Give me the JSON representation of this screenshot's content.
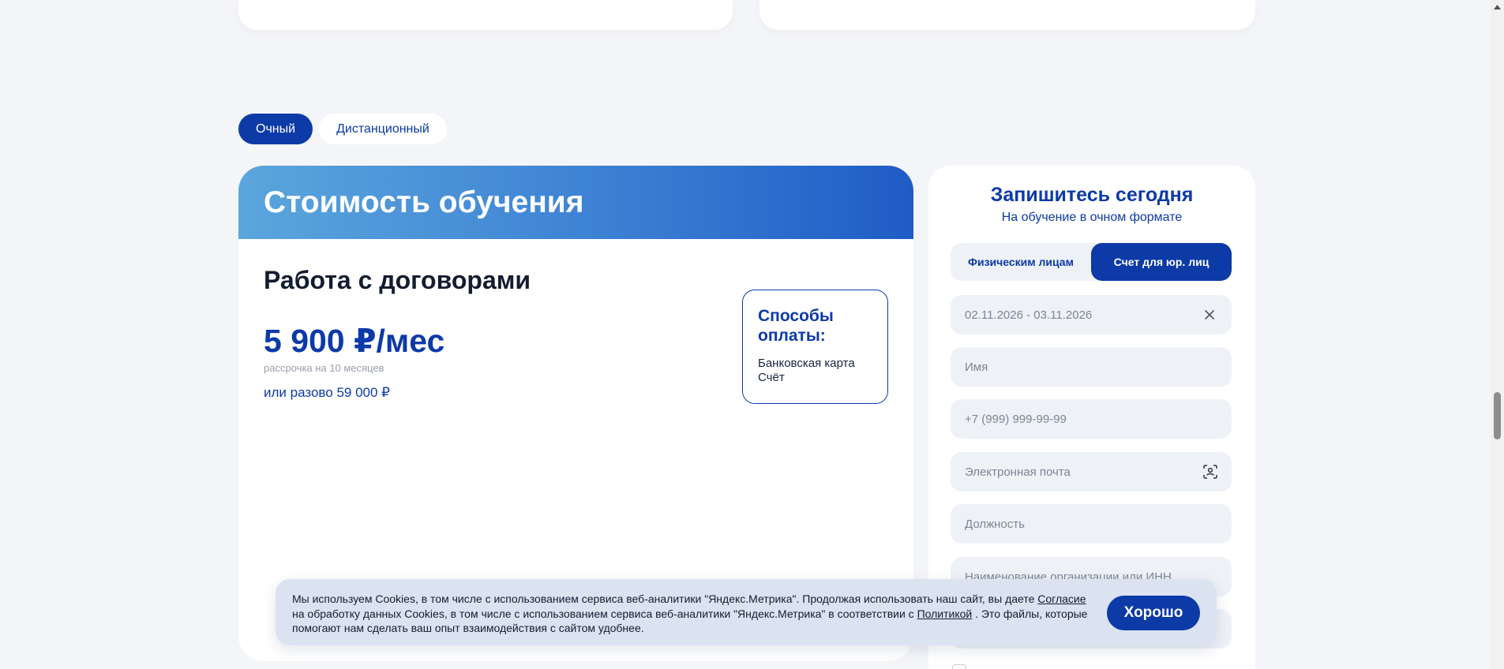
{
  "format_tabs": [
    {
      "label": "Очный",
      "active": true
    },
    {
      "label": "Дистанционный",
      "active": false
    }
  ],
  "price_card": {
    "header": "Стоимость обучения",
    "course_title": "Работа с договорами",
    "price_monthly": "5 900 ₽/мес",
    "installment_note": "рассрочка на 10 месяцев",
    "once_prefix": "или разово",
    "once_price": "59 000 ₽",
    "payment_methods": {
      "title": "Способы оплаты:",
      "items": [
        "Банковская карта",
        "Счёт"
      ]
    }
  },
  "form": {
    "title": "Запишитесь сегодня",
    "subtitle": "На обучение в очном формате",
    "person_tabs": [
      {
        "label": "Физическим лицам",
        "active": false
      },
      {
        "label": "Счет для юр. лиц",
        "active": true
      }
    ],
    "date_range": "02.11.2026 - 03.11.2026",
    "fields": {
      "name_placeholder": "Имя",
      "phone_placeholder": "+7 (999) 999-99-99",
      "email_placeholder": "Электронная почта",
      "position_placeholder": "Должность",
      "org_placeholder": "Наименование организации или ИНН"
    }
  },
  "cookie": {
    "text_1": "Мы используем Cookies, в том числе с использованием сервиса веб-аналитики \"Яндекс.Метрика\". Продолжая использовать наш сайт, вы даете",
    "link_consent": "Согласие",
    "text_2": "на обработку данных Cookies, в том числе с использованием сервиса веб-аналитики \"Яндекс.Метрика\" в соответствии с",
    "link_policy": "Политикой",
    "text_3": ". Это файлы, которые помогают нам сделать ваш опыт взаимодействия с сайтом удобнее.",
    "button": "Хорошо"
  },
  "colors": {
    "brand_blue": "#0c3aa7",
    "page_bg": "#f4f5f8",
    "field_bg": "#eef1f6",
    "cookie_bg": "#dbe3f1"
  },
  "icons": {
    "clear": "close-icon",
    "email_autofill": "contact-card-icon",
    "scroll_up": "chevron-up-icon"
  }
}
